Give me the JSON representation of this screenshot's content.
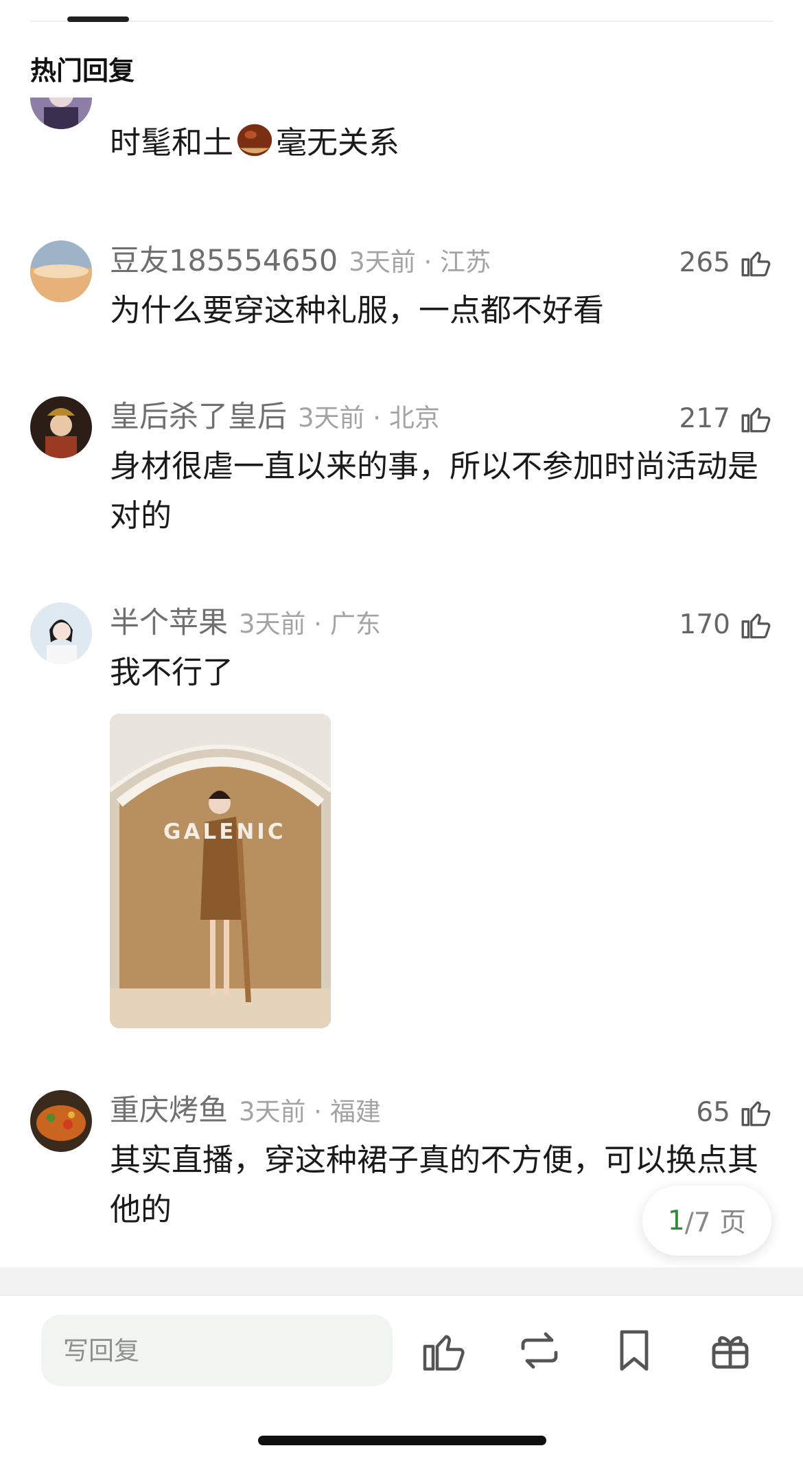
{
  "header": {
    "section_title": "热门回复"
  },
  "comments": [
    {
      "name": "",
      "time_location": "",
      "likes": "",
      "text_before": "时髦和土",
      "text_after": "毫无关系"
    },
    {
      "name": "豆友185554650",
      "time_location": "3天前 · 江苏",
      "likes": "265",
      "text": "为什么要穿这种礼服，一点都不好看"
    },
    {
      "name": "皇后杀了皇后",
      "time_location": "3天前 · 北京",
      "likes": "217",
      "text": "身材很虐一直以来的事，所以不参加时尚活动是对的"
    },
    {
      "name": "半个苹果",
      "time_location": "3天前 · 广东",
      "likes": "170",
      "text": "我不行了",
      "image_logo_text": "GALENIC"
    },
    {
      "name": "重庆烤鱼",
      "time_location": "3天前 · 福建",
      "likes": "65",
      "text": "其实直播，穿这种裙子真的不方便，可以换点其他的"
    }
  ],
  "pager": {
    "current": "1",
    "total": "/7 页"
  },
  "bottom_bar": {
    "reply_placeholder": "写回复"
  },
  "icons": [
    "thumbs-up-icon",
    "repost-icon",
    "bookmark-icon",
    "gift-icon",
    "chestnut-emoji"
  ]
}
